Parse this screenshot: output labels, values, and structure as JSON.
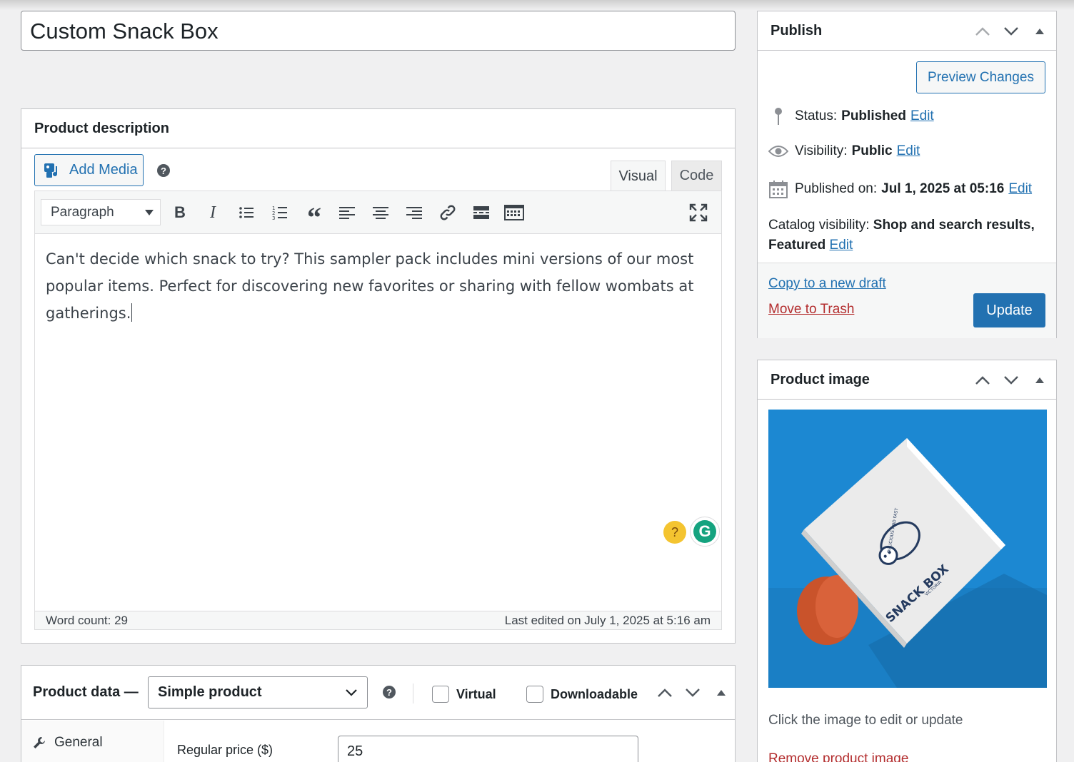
{
  "title": {
    "value": "Custom Snack Box"
  },
  "description_box": {
    "heading": "Product description",
    "add_media_label": "Add Media",
    "help_icon": "?",
    "tabs": [
      {
        "label": "Visual",
        "active": true
      },
      {
        "label": "Code",
        "active": false
      }
    ],
    "format_select": "Paragraph",
    "toolbar_icons": [
      "bold-icon",
      "italic-icon",
      "bulleted-list-icon",
      "numbered-list-icon",
      "blockquote-icon",
      "align-left-icon",
      "align-center-icon",
      "align-right-icon",
      "link-icon",
      "read-more-icon",
      "toolbar-toggle-icon",
      "fullscreen-icon"
    ],
    "content": "Can't decide which snack to try? This sampler pack includes mini versions of our most popular items. Perfect for discovering new favorites or sharing with fellow wombats at gatherings.",
    "word_count": "Word count: 29",
    "last_edited": "Last edited on July 1, 2025 at 5:16 am"
  },
  "product_data": {
    "title": "Product data —",
    "type_select": "Simple product",
    "virtual_label": "Virtual",
    "downloadable_label": "Downloadable",
    "tab_general": "General",
    "regular_price_label": "Regular price ($)",
    "regular_price_value": "25"
  },
  "publish": {
    "heading": "Publish",
    "preview_label": "Preview Changes",
    "status_label": "Status:",
    "status_value": "Published",
    "visibility_label": "Visibility:",
    "visibility_value": "Public",
    "published_label": "Published on:",
    "published_value": "Jul 1, 2025 at 05:16",
    "catalog_label": "Catalog visibility:",
    "catalog_value": "Shop and search results, Featured",
    "edit_label": "Edit",
    "copy_label": "Copy to a new draft",
    "trash_label": "Move to Trash",
    "update_label": "Update"
  },
  "product_image": {
    "heading": "Product image",
    "hint": "Click the image to edit or update",
    "remove_label": "Remove product image",
    "box_brand": "SNACK BOX",
    "box_tagline": "DELICIOUS AND FAST",
    "box_location": "VICTORIA"
  },
  "colors": {
    "accent": "#2271b1",
    "danger": "#b32d2e",
    "image_bg": "#1a86d0"
  }
}
